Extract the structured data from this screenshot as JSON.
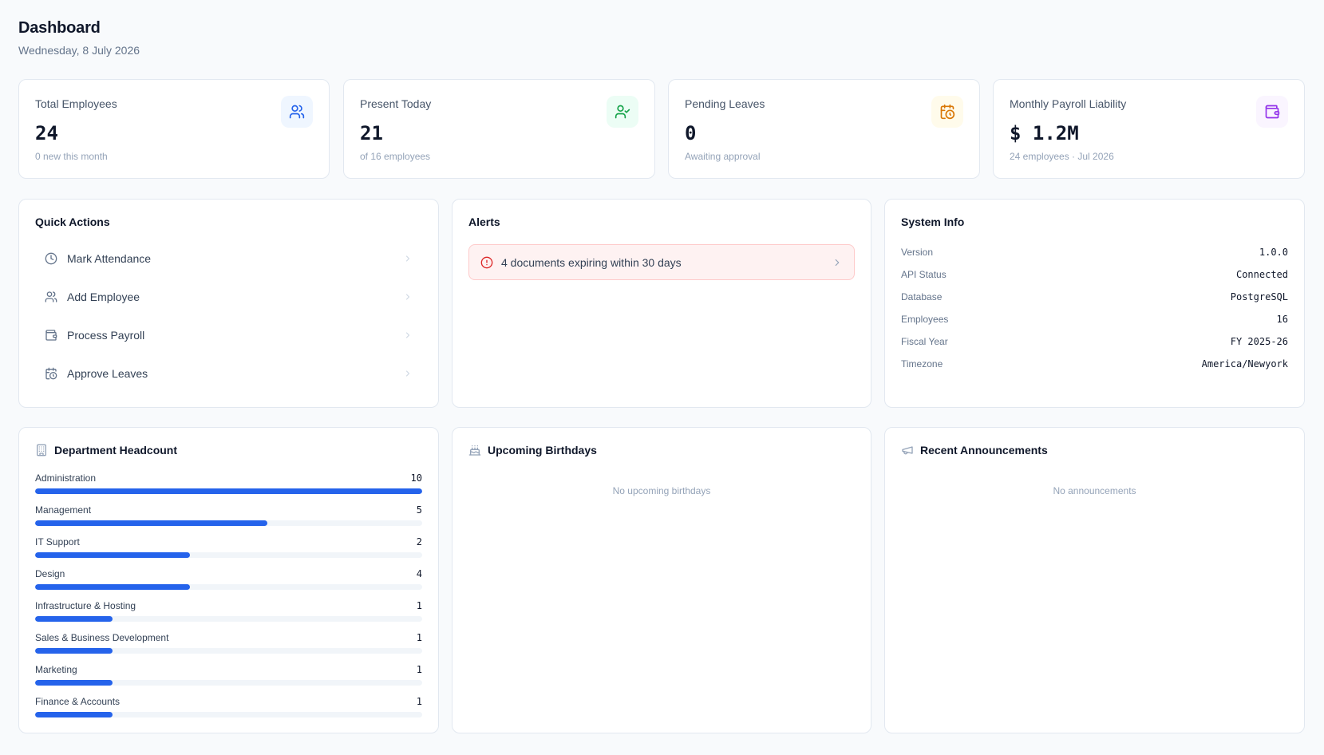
{
  "header": {
    "title": "Dashboard",
    "date": "Wednesday, 8 July 2026"
  },
  "stats": [
    {
      "label": "Total Employees",
      "value": "24",
      "sub": "0 new this month",
      "icon": "users-icon",
      "color": "#2563eb",
      "bg": "#eff6ff"
    },
    {
      "label": "Present Today",
      "value": "21",
      "sub": "of 16 employees",
      "icon": "user-check-icon",
      "color": "#16a34a",
      "bg": "#ecfdf5"
    },
    {
      "label": "Pending Leaves",
      "value": "0",
      "sub": "Awaiting approval",
      "icon": "calendar-clock-icon",
      "color": "#d97706",
      "bg": "#fffbeb"
    },
    {
      "label": "Monthly Payroll Liability",
      "value": "$ 1.2M",
      "sub": "24 employees · Jul 2026",
      "icon": "wallet-icon",
      "color": "#9333ea",
      "bg": "#faf5ff"
    }
  ],
  "quick_actions": {
    "title": "Quick Actions",
    "items": [
      {
        "label": "Mark Attendance",
        "icon": "clock-icon"
      },
      {
        "label": "Add Employee",
        "icon": "users-icon"
      },
      {
        "label": "Process Payroll",
        "icon": "wallet-icon"
      },
      {
        "label": "Approve Leaves",
        "icon": "calendar-clock-icon"
      }
    ]
  },
  "alerts": {
    "title": "Alerts",
    "items": [
      {
        "text": "4 documents expiring within 30 days",
        "icon": "alert-circle-icon",
        "color": "#dc2626"
      }
    ]
  },
  "system_info": {
    "title": "System Info",
    "rows": [
      {
        "key": "Version",
        "value": "1.0.0"
      },
      {
        "key": "API Status",
        "value": "Connected"
      },
      {
        "key": "Database",
        "value": "PostgreSQL"
      },
      {
        "key": "Employees",
        "value": "16"
      },
      {
        "key": "Fiscal Year",
        "value": "FY 2025-26"
      },
      {
        "key": "Timezone",
        "value": "America/Newyork"
      }
    ]
  },
  "department_headcount": {
    "title": "Department Headcount",
    "icon": "building-icon",
    "bar_color": "#2563eb",
    "departments": [
      {
        "name": "Administration",
        "count": "10",
        "fraction": 1.0
      },
      {
        "name": "Management",
        "count": "5",
        "fraction": 0.6
      },
      {
        "name": "IT Support",
        "count": "2",
        "fraction": 0.4
      },
      {
        "name": "Design",
        "count": "4",
        "fraction": 0.4
      },
      {
        "name": "Infrastructure & Hosting",
        "count": "1",
        "fraction": 0.2
      },
      {
        "name": "Sales & Business Development",
        "count": "1",
        "fraction": 0.2
      },
      {
        "name": "Marketing",
        "count": "1",
        "fraction": 0.2
      },
      {
        "name": "Finance & Accounts",
        "count": "1",
        "fraction": 0.2
      }
    ]
  },
  "birthdays": {
    "title": "Upcoming Birthdays",
    "icon": "cake-icon",
    "empty": "No upcoming birthdays"
  },
  "announcements": {
    "title": "Recent Announcements",
    "icon": "megaphone-icon",
    "empty": "No announcements"
  }
}
